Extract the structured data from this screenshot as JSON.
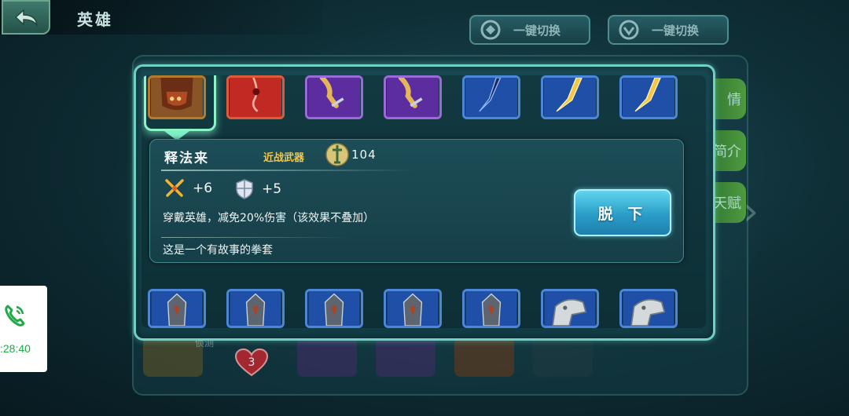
{
  "header": {
    "title": "英雄",
    "switch_button_1": "一键切换",
    "switch_button_2": "一键切换"
  },
  "background": {
    "tab_labels": [
      "情",
      "简介",
      "天赋"
    ],
    "slot_label": "侦测",
    "badge_count": "3"
  },
  "inventory": {
    "top_row": [
      {
        "icon": "gauntlet-icon",
        "color": "#8a5526"
      },
      {
        "icon": "red-pendant-icon",
        "color": "#c02a22"
      },
      {
        "icon": "dagger-purple-icon",
        "color": "#5b2d9e"
      },
      {
        "icon": "dagger-purple-icon",
        "color": "#5b2d9e"
      },
      {
        "icon": "blade-blue-icon",
        "color": "#1f4fa6"
      },
      {
        "icon": "golden-sword-icon",
        "color": "#1f4fa6"
      },
      {
        "icon": "golden-sword-icon",
        "color": "#1f4fa6"
      }
    ],
    "bottom_row": [
      {
        "icon": "helmet-icon"
      },
      {
        "icon": "helmet-icon"
      },
      {
        "icon": "helmet-icon"
      },
      {
        "icon": "helmet-icon"
      },
      {
        "icon": "helmet-icon"
      },
      {
        "icon": "shoulder-armor-icon"
      },
      {
        "icon": "shoulder-armor-icon"
      }
    ]
  },
  "tooltip": {
    "name": "释法来",
    "type": "近战武器",
    "level": "104",
    "attack": "+6",
    "defense": "+5",
    "effect": "穿戴英雄，减免20%伤害（该效果不叠加）",
    "lore": "这是一个有故事的拳套",
    "unequip_label": "脱 下"
  },
  "call_widget": {
    "time": ":28:40"
  },
  "colors": {
    "accent": "#6fd0c4",
    "button": "#2a9dc6",
    "type_text": "#f1c84b",
    "call_green": "#1faa46"
  }
}
